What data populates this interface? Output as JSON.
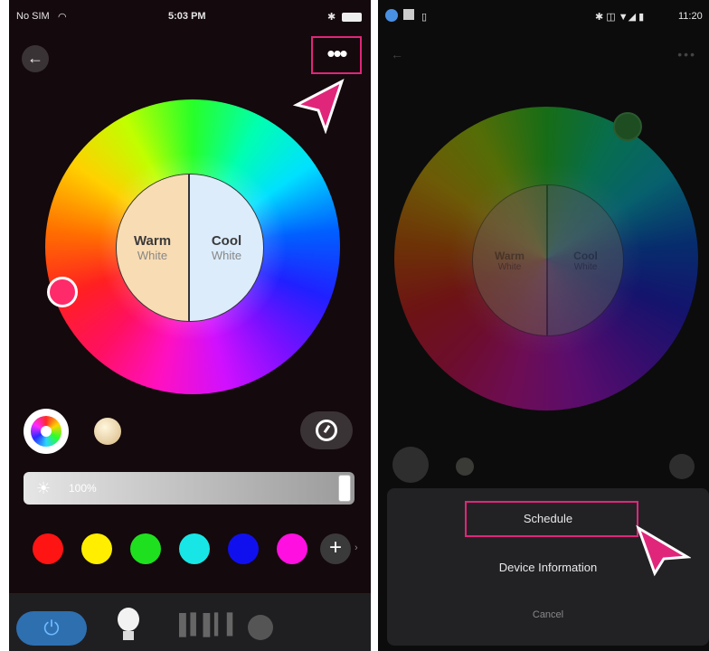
{
  "left_panel": {
    "status": {
      "carrier": "No SIM",
      "wifi": "wifi-icon",
      "time": "5:03 PM",
      "battery": "battery-icon"
    },
    "header": {
      "back_icon": "back-arrow-icon",
      "more_label": "•••"
    },
    "wheel": {
      "warm_title": "Warm",
      "warm_sub": "White",
      "cool_title": "Cool",
      "cool_sub": "White"
    },
    "brightness": {
      "label": "100%",
      "level_percent": 100
    },
    "swatches": [
      "#ff1414",
      "#ffee00",
      "#1fe01f",
      "#18e6e6",
      "#1010ee",
      "#ff10e0"
    ],
    "add_label": "+",
    "add_arrow": "›",
    "highlight_color": "#e0267a"
  },
  "right_panel": {
    "status": {
      "time": "11:20"
    },
    "wheel": {
      "warm_title": "Warm",
      "warm_sub": "White",
      "cool_title": "Cool",
      "cool_sub": "White"
    },
    "sheet": {
      "items": [
        "Schedule",
        "Device Information"
      ],
      "cancel": "Cancel"
    }
  }
}
